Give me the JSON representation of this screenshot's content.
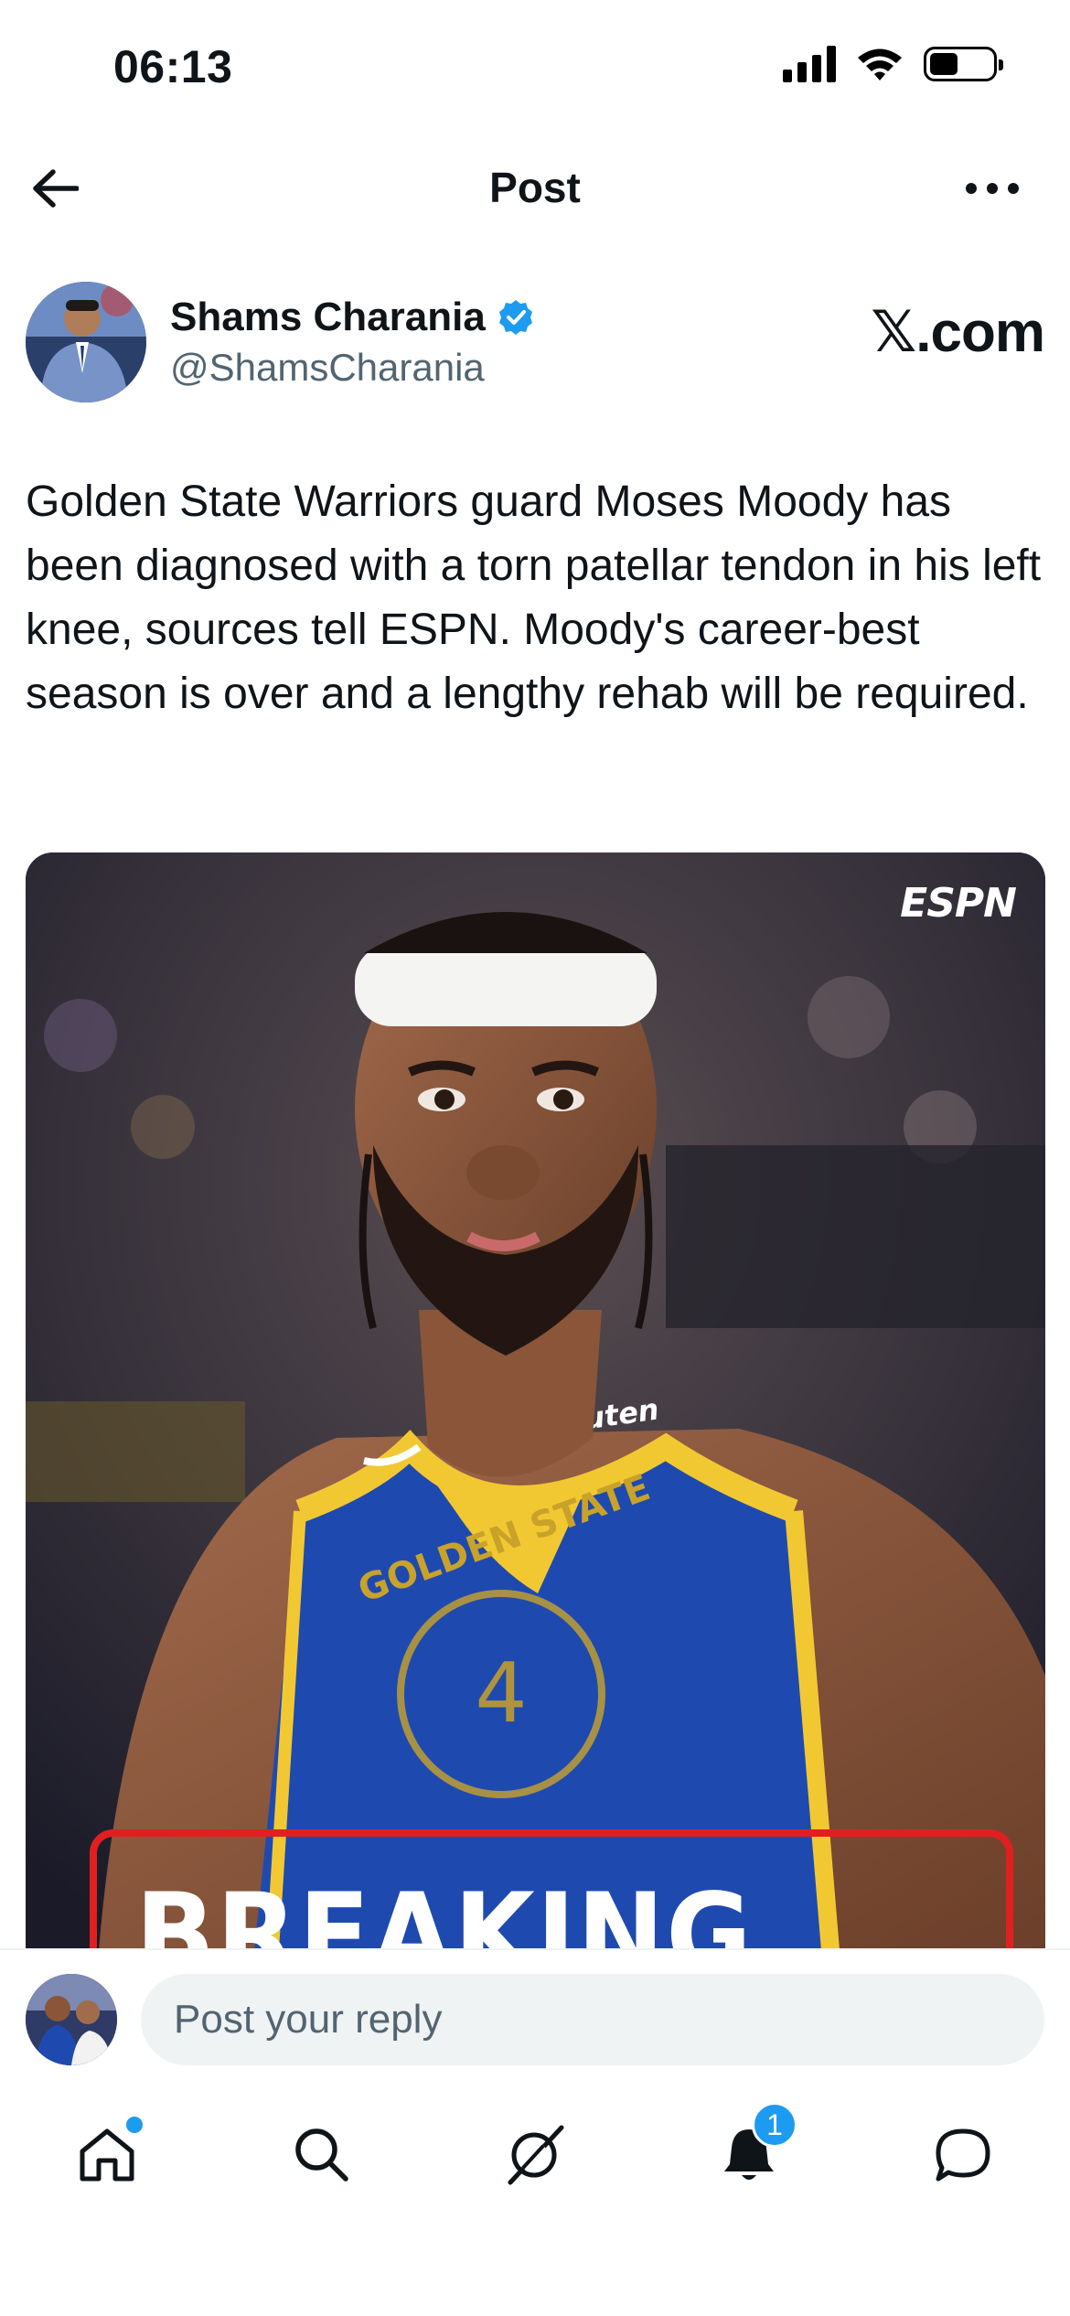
{
  "status_bar": {
    "time": "06:13"
  },
  "header": {
    "title": "Post"
  },
  "author": {
    "display_name": "Shams Charania",
    "handle": "@ShamsCharania",
    "source": "𝕏.com"
  },
  "tweet": {
    "text": "Golden State Warriors guard Moses Moody has been diagnosed with a torn patellar tendon in his left knee, sources tell ESPN. Moody's career-best season is over and a lengthy rehab will be required."
  },
  "media": {
    "logo": "ESPN",
    "banner": "BREAKING NEWS",
    "jersey_sponsor": "Rakuten",
    "jersey_text": "GOLDEN STATE",
    "jersey_number": "4"
  },
  "reply": {
    "placeholder": "Post your reply"
  },
  "nav": {
    "notifications_count": "1",
    "icons": [
      "home-icon",
      "search-icon",
      "grok-icon",
      "bell-icon",
      "messages-icon"
    ]
  },
  "colors": {
    "accent": "#1d9bf0",
    "text": "#0f1419",
    "muted": "#536471",
    "banner_red": "#e02020"
  }
}
